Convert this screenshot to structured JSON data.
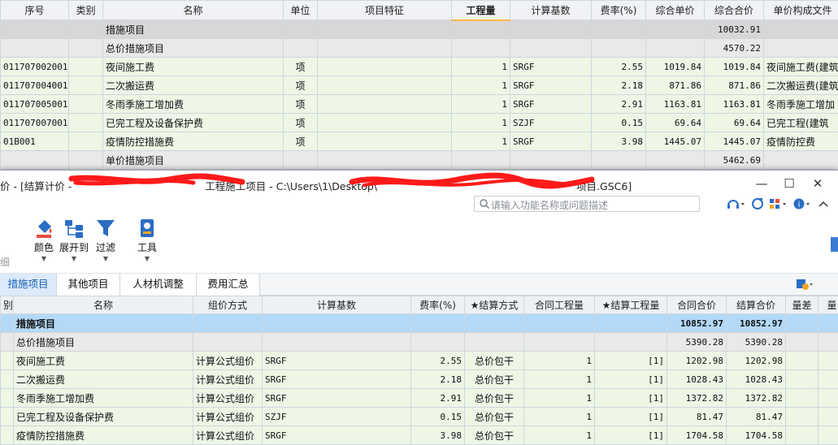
{
  "top_grid": {
    "headers": [
      "序号",
      "类别",
      "名称",
      "单位",
      "项目特征",
      "工程量",
      "计算基数",
      "费率(%)",
      "综合单价",
      "综合合价",
      "单价构成文件"
    ],
    "group_row": {
      "name": "措施项目",
      "total": "10032.91"
    },
    "subtotal_row": {
      "name": "总价措施项目",
      "total": "4570.22"
    },
    "items": [
      {
        "code": "011707002001",
        "name": "夜间施工费",
        "unit": "项",
        "qty": "1",
        "base": "SRGF",
        "rate": "2.55",
        "unit_price": "1019.84",
        "total": "1019.84",
        "file": "夜间施工费(建筑"
      },
      {
        "code": "011707004001",
        "name": "二次搬运费",
        "unit": "项",
        "qty": "1",
        "base": "SRGF",
        "rate": "2.18",
        "unit_price": "871.86",
        "total": "871.86",
        "file": "二次搬运费(建筑"
      },
      {
        "code": "011707005001",
        "name": "冬雨季施工增加费",
        "unit": "项",
        "qty": "1",
        "base": "SRGF",
        "rate": "2.91",
        "unit_price": "1163.81",
        "total": "1163.81",
        "file": "冬雨季施工增加"
      },
      {
        "code": "011707007001",
        "name": "已完工程及设备保护费",
        "unit": "项",
        "qty": "1",
        "base": "SZJF",
        "rate": "0.15",
        "unit_price": "69.64",
        "total": "69.64",
        "file": "已完工程(建筑"
      },
      {
        "code": "01B001",
        "name": "疫情防控措施费",
        "unit": "项",
        "qty": "1",
        "base": "SRGF",
        "rate": "3.98",
        "unit_price": "1445.07",
        "total": "1445.07",
        "file": "疫情防控费"
      }
    ],
    "unit_price_row": {
      "name": "单价措施项目",
      "total": "5462.69"
    }
  },
  "window": {
    "title_prefix": "价 - [结算计价 - ",
    "title_mid": "工程施工项目 - C:\\Users\\1\\Desktop\\",
    "title_suffix": "项目.GSC6]",
    "controls": {
      "minimize": "—",
      "maximize": "☐",
      "close": "✕"
    },
    "search_placeholder": "请输入功能名称或问题描述",
    "ribbon": {
      "side_label": "细",
      "buttons": [
        {
          "label": "颜色",
          "icon": "color-bucket-icon"
        },
        {
          "label": "展开到",
          "icon": "expand-tree-icon"
        },
        {
          "label": "过滤",
          "icon": "filter-funnel-icon"
        },
        {
          "label": "工具",
          "icon": "tools-icon"
        }
      ]
    },
    "tabs": [
      "措施项目",
      "其他项目",
      "人材机调整",
      "费用汇总"
    ],
    "active_tab": "措施项目"
  },
  "bottom_grid": {
    "headers": [
      "别",
      "名称",
      "组价方式",
      "计算基数",
      "费率(%)",
      "★结算方式",
      "合同工程量",
      "★结算工程量",
      "合同合价",
      "结算合价",
      "量差",
      "量"
    ],
    "group_row": {
      "name": "措施项目",
      "contract_total": "10852.97",
      "settle_total": "10852.97"
    },
    "subtotal_row": {
      "name": "总价措施项目",
      "contract_total": "5390.28",
      "settle_total": "5390.28"
    },
    "items": [
      {
        "name": "夜间施工费",
        "method": "计算公式组价",
        "base": "SRGF",
        "rate": "2.55",
        "settle_mode": "总价包干",
        "contract_qty": "1",
        "settle_qty": "[1]",
        "contract_total": "1202.98",
        "settle_total": "1202.98"
      },
      {
        "name": "二次搬运费",
        "method": "计算公式组价",
        "base": "SRGF",
        "rate": "2.18",
        "settle_mode": "总价包干",
        "contract_qty": "1",
        "settle_qty": "[1]",
        "contract_total": "1028.43",
        "settle_total": "1028.43"
      },
      {
        "name": "冬雨季施工增加费",
        "method": "计算公式组价",
        "base": "SRGF",
        "rate": "2.91",
        "settle_mode": "总价包干",
        "contract_qty": "1",
        "settle_qty": "[1]",
        "contract_total": "1372.82",
        "settle_total": "1372.82"
      },
      {
        "name": "已完工程及设备保护费",
        "method": "计算公式组价",
        "base": "SZJF",
        "rate": "0.15",
        "settle_mode": "总价包干",
        "contract_qty": "1",
        "settle_qty": "[1]",
        "contract_total": "81.47",
        "settle_total": "81.47"
      },
      {
        "name": "疫情防控措施费",
        "method": "计算公式组价",
        "base": "SRGF",
        "rate": "3.98",
        "settle_mode": "总价包干",
        "contract_qty": "1",
        "settle_qty": "[1]",
        "contract_total": "1704.58",
        "settle_total": "1704.58"
      }
    ]
  },
  "colors": {
    "selected_row": "#b3d9f7",
    "group_row": "#d7d7d7",
    "item_row": "#eef6e6",
    "accent": "#2b6cc4",
    "redaction": "#ff1a1a"
  }
}
